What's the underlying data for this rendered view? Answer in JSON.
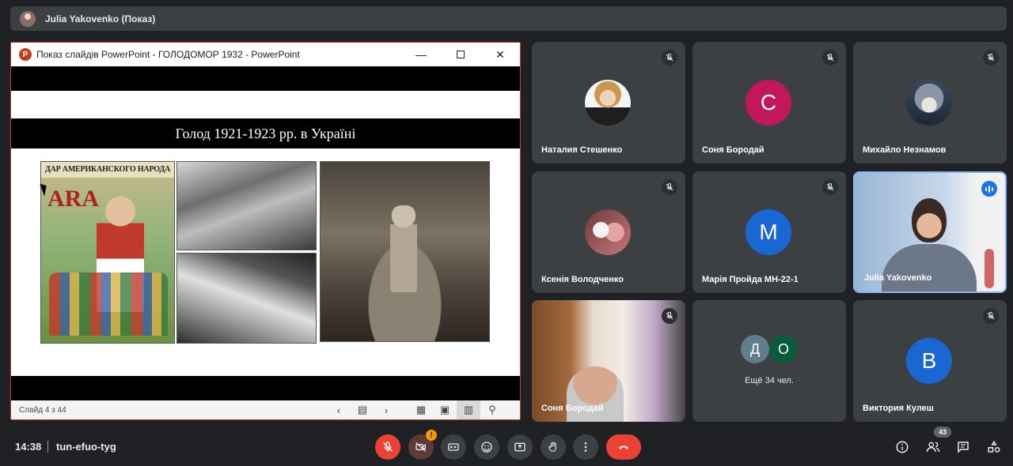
{
  "top_bar": {
    "presenter_title": "Julia Yakovenko (Показ)"
  },
  "presentation": {
    "window_title": "Показ слайдів PowerPoint  -  ГОЛОДОМОР 1932 - PowerPoint",
    "window_controls": {
      "minimize": "—",
      "maximize": "",
      "close": "✕"
    },
    "slide_heading": "Голод  1921-1923 рр.  в Україні",
    "poster_caption": "ДАР АМЕРИКАНСКОГО НАРОДА",
    "poster_logo": "ARA",
    "status": {
      "slide_number": "Слайд 4 з 44",
      "prev": "‹",
      "next": "›",
      "view_buttons": [
        "▤",
        "▦",
        "▣",
        "▥",
        "⚲"
      ]
    }
  },
  "participants": [
    {
      "name": "Наталия Стешенко",
      "avatar_type": "photo",
      "muted": true
    },
    {
      "name": "Соня Бородай",
      "avatar_letter": "С",
      "avatar_color": "#c2185b",
      "muted": true
    },
    {
      "name": "Михайло Незнамов",
      "avatar_type": "photo",
      "muted": true
    },
    {
      "name": "Ксенія Володченко",
      "avatar_type": "photo",
      "muted": true
    },
    {
      "name": "Марія Пройда МН-22-1",
      "avatar_letter": "М",
      "avatar_color": "#1967d2",
      "muted": true
    },
    {
      "name": "Julia Yakovenko",
      "avatar_type": "video",
      "speaking": true
    },
    {
      "name": "Соня Бородай",
      "avatar_type": "video",
      "muted": true
    },
    {
      "more_avatars": [
        "Д",
        "О"
      ],
      "more_colors": [
        "#607d8b",
        "#0b5a3b"
      ],
      "more_label": "Ещё 34 чел."
    },
    {
      "name": "Виктория Кулеш",
      "avatar_letter": "В",
      "avatar_color": "#1967d2",
      "muted": true
    }
  ],
  "bottom_bar": {
    "time": "14:38",
    "meeting_code": "tun-efuo-tyg",
    "camera_warning": "!",
    "people_count": "43",
    "colors": {
      "end_call": "#ea4335",
      "mic_off": "#ea4335"
    }
  }
}
